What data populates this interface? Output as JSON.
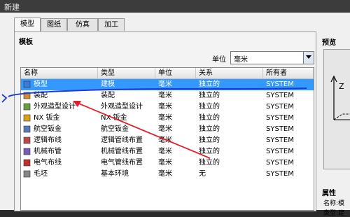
{
  "window": {
    "title": "新建"
  },
  "tabs": [
    {
      "label": "模型",
      "active": true
    },
    {
      "label": "图纸",
      "active": false
    },
    {
      "label": "仿真",
      "active": false
    },
    {
      "label": "加工",
      "active": false
    }
  ],
  "templates": {
    "title": "模板",
    "unit_label": "单位",
    "unit_value": "毫米",
    "columns": [
      "名称",
      "类型",
      "单位",
      "关系",
      "所有者"
    ],
    "rows": [
      {
        "name": "模型",
        "type": "建模",
        "unit": "毫米",
        "relation": "独立的",
        "owner": "SYSTEM",
        "selected": true,
        "icon": "model-icon"
      },
      {
        "name": "装配",
        "type": "装配",
        "unit": "毫米",
        "relation": "独立的",
        "owner": "SYSTEM",
        "selected": false,
        "icon": "assembly-icon"
      },
      {
        "name": "外观造型设计",
        "type": "外观造型设计",
        "unit": "毫米",
        "relation": "独立的",
        "owner": "SYSTEM",
        "selected": false,
        "icon": "shape-design-icon"
      },
      {
        "name": "NX 钣金",
        "type": "NX 钣金",
        "unit": "毫米",
        "relation": "独立的",
        "owner": "SYSTEM",
        "selected": false,
        "icon": "sheet-metal-icon"
      },
      {
        "name": "航空钣金",
        "type": "航空钣金",
        "unit": "毫米",
        "relation": "独立的",
        "owner": "SYSTEM",
        "selected": false,
        "icon": "aero-sheet-metal-icon"
      },
      {
        "name": "逻辑布线",
        "type": "逻辑管线布置",
        "unit": "毫米",
        "relation": "独立的",
        "owner": "SYSTEM",
        "selected": false,
        "icon": "logical-routing-icon"
      },
      {
        "name": "机械布管",
        "type": "机械管线布置",
        "unit": "毫米",
        "relation": "独立的",
        "owner": "SYSTEM",
        "selected": false,
        "icon": "mechanical-routing-icon"
      },
      {
        "name": "电气布线",
        "type": "电气管线布置",
        "unit": "毫米",
        "relation": "独立的",
        "owner": "SYSTEM",
        "selected": false,
        "icon": "electrical-routing-icon"
      },
      {
        "name": "毛坯",
        "type": "基本环境",
        "unit": "毫米",
        "relation": "无",
        "owner": "SYSTEM",
        "selected": false,
        "icon": "blank-icon"
      }
    ]
  },
  "preview": {
    "title": "预览",
    "axis": "Z"
  },
  "properties": {
    "title": "属性",
    "lines": [
      {
        "key": "名称:",
        "value": "模"
      },
      {
        "key": "类型:",
        "value": "建"
      }
    ]
  },
  "colors": {
    "selection": "#3399ff",
    "annotation_blue": "#1f3bd6",
    "annotation_red": "#e0202a"
  }
}
